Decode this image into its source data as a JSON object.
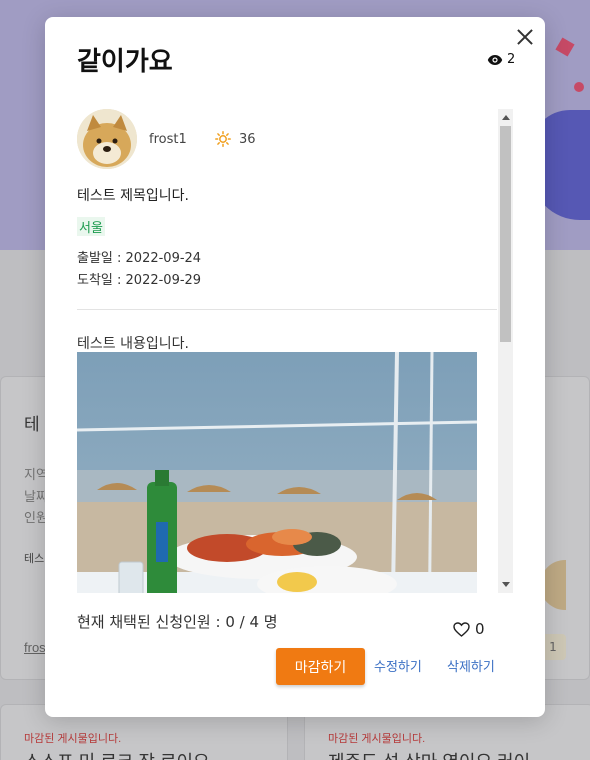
{
  "background": {
    "card_title": "테",
    "card_meta": [
      "지역",
      "날짜",
      "인원"
    ],
    "card_small": "테스",
    "card_user": "fros",
    "card_like_count": "1",
    "closed_label_left": "마감된 게시물입니다.",
    "closed_label_right": "마감된 게시물입니다.",
    "bottom_text_left": "스스프 미 르크 장 르이요",
    "bottom_text_right": "제주도 섬 상마 였이오 러이"
  },
  "modal": {
    "title": "같이가요",
    "view_count": "2",
    "author": {
      "name": "frost1",
      "temperature": "36"
    },
    "post": {
      "title": "테스트 제목입니다.",
      "region": "서울",
      "depart_date": "출발일 : 2022-09-24",
      "arrive_date": "도착일 : 2022-09-29",
      "content": "테스트 내용입니다."
    },
    "applicants_text": "현재 채택된 신청인원 : 0 / 4 명",
    "like_count": "0",
    "buttons": {
      "close_recruit": "마감하기",
      "edit": "수정하기",
      "delete": "삭제하기"
    },
    "icons": {
      "close": "close-icon",
      "views": "eye-icon",
      "temperature": "sun-icon",
      "like": "heart-icon"
    },
    "colors": {
      "primary_button": "#f07a12",
      "link": "#3a6fc4",
      "region_text": "#1d9b4f",
      "temperature_icon": "#f0a020"
    }
  }
}
